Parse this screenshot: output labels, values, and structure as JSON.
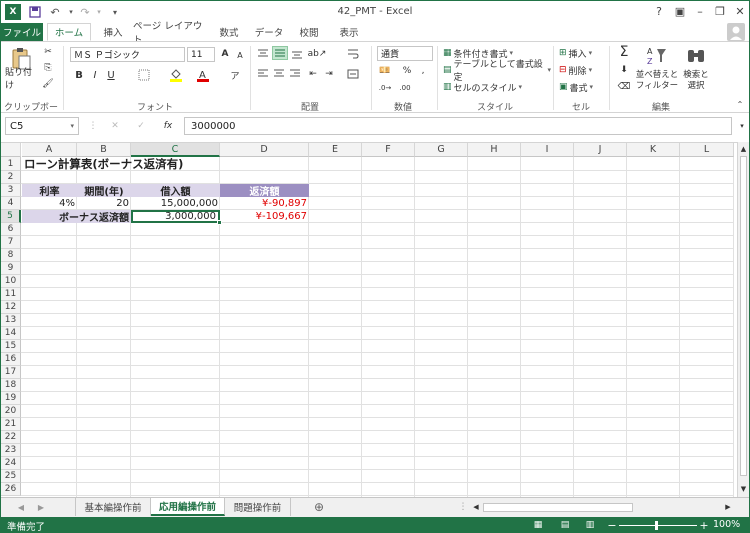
{
  "titlebar": {
    "title": "42_PMT - Excel",
    "help": "?",
    "minimize": "–",
    "restore": "❐",
    "close": "✕"
  },
  "tabs": [
    "ファイル",
    "ホーム",
    "挿入",
    "ページ レイアウト",
    "数式",
    "データ",
    "校閲",
    "表示"
  ],
  "ribbon": {
    "clipboard": {
      "paste": "貼り付け",
      "label": "クリップボード"
    },
    "font": {
      "name": "ＭＳ Ｐゴシック",
      "size": "11",
      "bold": "B",
      "italic": "I",
      "underline": "U",
      "grow": "A",
      "shrink": "A",
      "label": "フォント"
    },
    "alignment": {
      "label": "配置"
    },
    "number": {
      "format": "通貨",
      "percent": "%",
      "comma": ",",
      "label": "数値"
    },
    "styles": {
      "conditional": "条件付き書式",
      "table": "テーブルとして書式設定",
      "cell": "セルのスタイル",
      "label": "スタイル"
    },
    "cells": {
      "insert": "挿入",
      "delete": "削除",
      "format": "書式",
      "label": "セル"
    },
    "editing": {
      "sort": "並べ替えと\nフィルター",
      "find": "検索と\n選択",
      "label": "編集"
    }
  },
  "formula_bar": {
    "name_box": "C5",
    "fx": "fx",
    "value": "3000000"
  },
  "columns": [
    "A",
    "B",
    "C",
    "D",
    "E",
    "F",
    "G",
    "H",
    "I",
    "J",
    "K",
    "L"
  ],
  "rows": [
    "1",
    "2",
    "3",
    "4",
    "5",
    "6",
    "7",
    "8",
    "9",
    "10",
    "11",
    "12",
    "13",
    "14",
    "15",
    "16",
    "17",
    "18",
    "19",
    "20",
    "21",
    "22",
    "23",
    "24",
    "25",
    "26"
  ],
  "cells": {
    "a1": "ローン計算表(ボーナス返済有)",
    "a3": "利率",
    "b3": "期間(年)",
    "c3": "借入額",
    "d3": "返済額",
    "a4": "4%",
    "b4": "20",
    "c4": "15,000,000",
    "d4": "¥-90,897",
    "ab5": "ボーナス返済額",
    "c5": "3,000,000",
    "d5": "¥-109,667"
  },
  "sheets": {
    "tab1": "基本編操作前",
    "tab2": "応用編操作前",
    "tab3": "問題操作前",
    "add": "⊕"
  },
  "status": {
    "ready": "準備完了",
    "zoom": "100%",
    "minus": "−",
    "plus": "+"
  },
  "colors": {
    "accent": "#217346",
    "header_bg": "#dcd6ea",
    "header_bg2": "#9c8fc2",
    "negative": "#e00000"
  }
}
